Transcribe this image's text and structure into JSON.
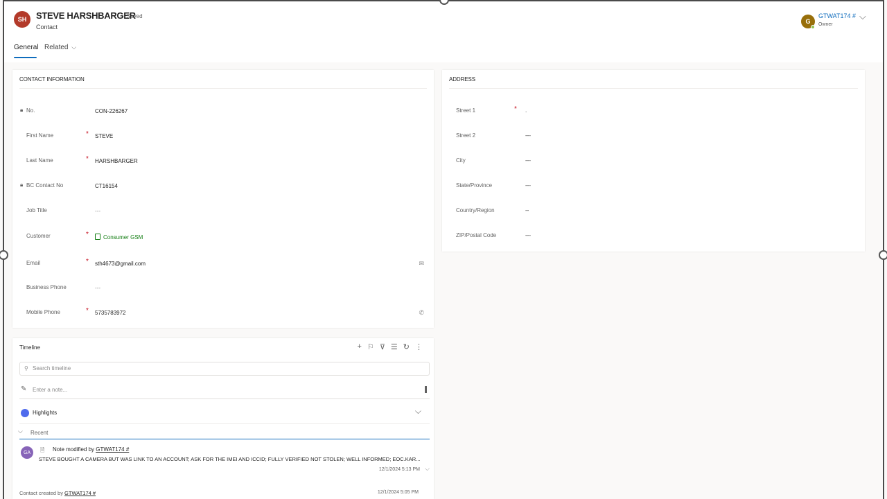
{
  "header": {
    "avatar_initials": "SH",
    "record_name": "STEVE HARSHBARGER",
    "saved_status": "- Saved",
    "entity_type": "Contact",
    "owner_initial": "G",
    "owner_name": "GTWAT174 #",
    "owner_label": "Owner"
  },
  "tabs": [
    {
      "label": "General"
    },
    {
      "label": "Related"
    }
  ],
  "contact": {
    "title": "CONTACT INFORMATION",
    "fields": [
      {
        "label": "No.",
        "value": "CON-226267"
      },
      {
        "label": "First Name",
        "value": "STEVE"
      },
      {
        "label": "Last Name",
        "value": "HARSHBARGER"
      },
      {
        "label": "BC Contact No",
        "value": "CT16154"
      },
      {
        "label": "Job Title",
        "value": "---"
      },
      {
        "label": "Customer",
        "value": "Consumer GSM"
      },
      {
        "label": "Email",
        "value": "sth4673@gmail.com"
      },
      {
        "label": "Business Phone",
        "value": "---"
      },
      {
        "label": "Mobile Phone",
        "value": "5735783972"
      }
    ]
  },
  "address": {
    "title": "ADDRESS",
    "fields": [
      {
        "label": "Street 1",
        "value": "."
      },
      {
        "label": "Street 2",
        "value": "---"
      },
      {
        "label": "City",
        "value": "---"
      },
      {
        "label": "State/Province",
        "value": "---"
      },
      {
        "label": "Country/Region",
        "value": "--"
      },
      {
        "label": "ZIP/Postal Code",
        "value": "---"
      }
    ]
  },
  "timeline": {
    "title": "Timeline",
    "search_placeholder": "Search timeline",
    "note_placeholder": "Enter a note...",
    "highlights_label": "Highlights",
    "recent_label": "Recent",
    "entry": {
      "avatar_initials": "GA",
      "heading_prefix": "Note modified by",
      "heading_user": "GTWAT174 #",
      "body": "STEVE BOUGHT A CAMERA BUT WAS LINK TO AN ACCOUNT; ASK FOR THE IMEI AND ICCID; FULLY VERIFIED NOT STOLEN; WELL INFORMED; EOC.KAR...",
      "timestamp": "12/1/2024 5:13 PM"
    },
    "created_prefix": "Contact created by",
    "created_user": "GTWAT174 #",
    "created_timestamp": "12/1/2024 5:05 PM"
  },
  "colors": {
    "record_avatar": "#b33a2a",
    "owner_avatar": "#986f0b",
    "accent": "#0f6cbd",
    "required": "#c50f1f",
    "lookup_link": "#107c10"
  }
}
